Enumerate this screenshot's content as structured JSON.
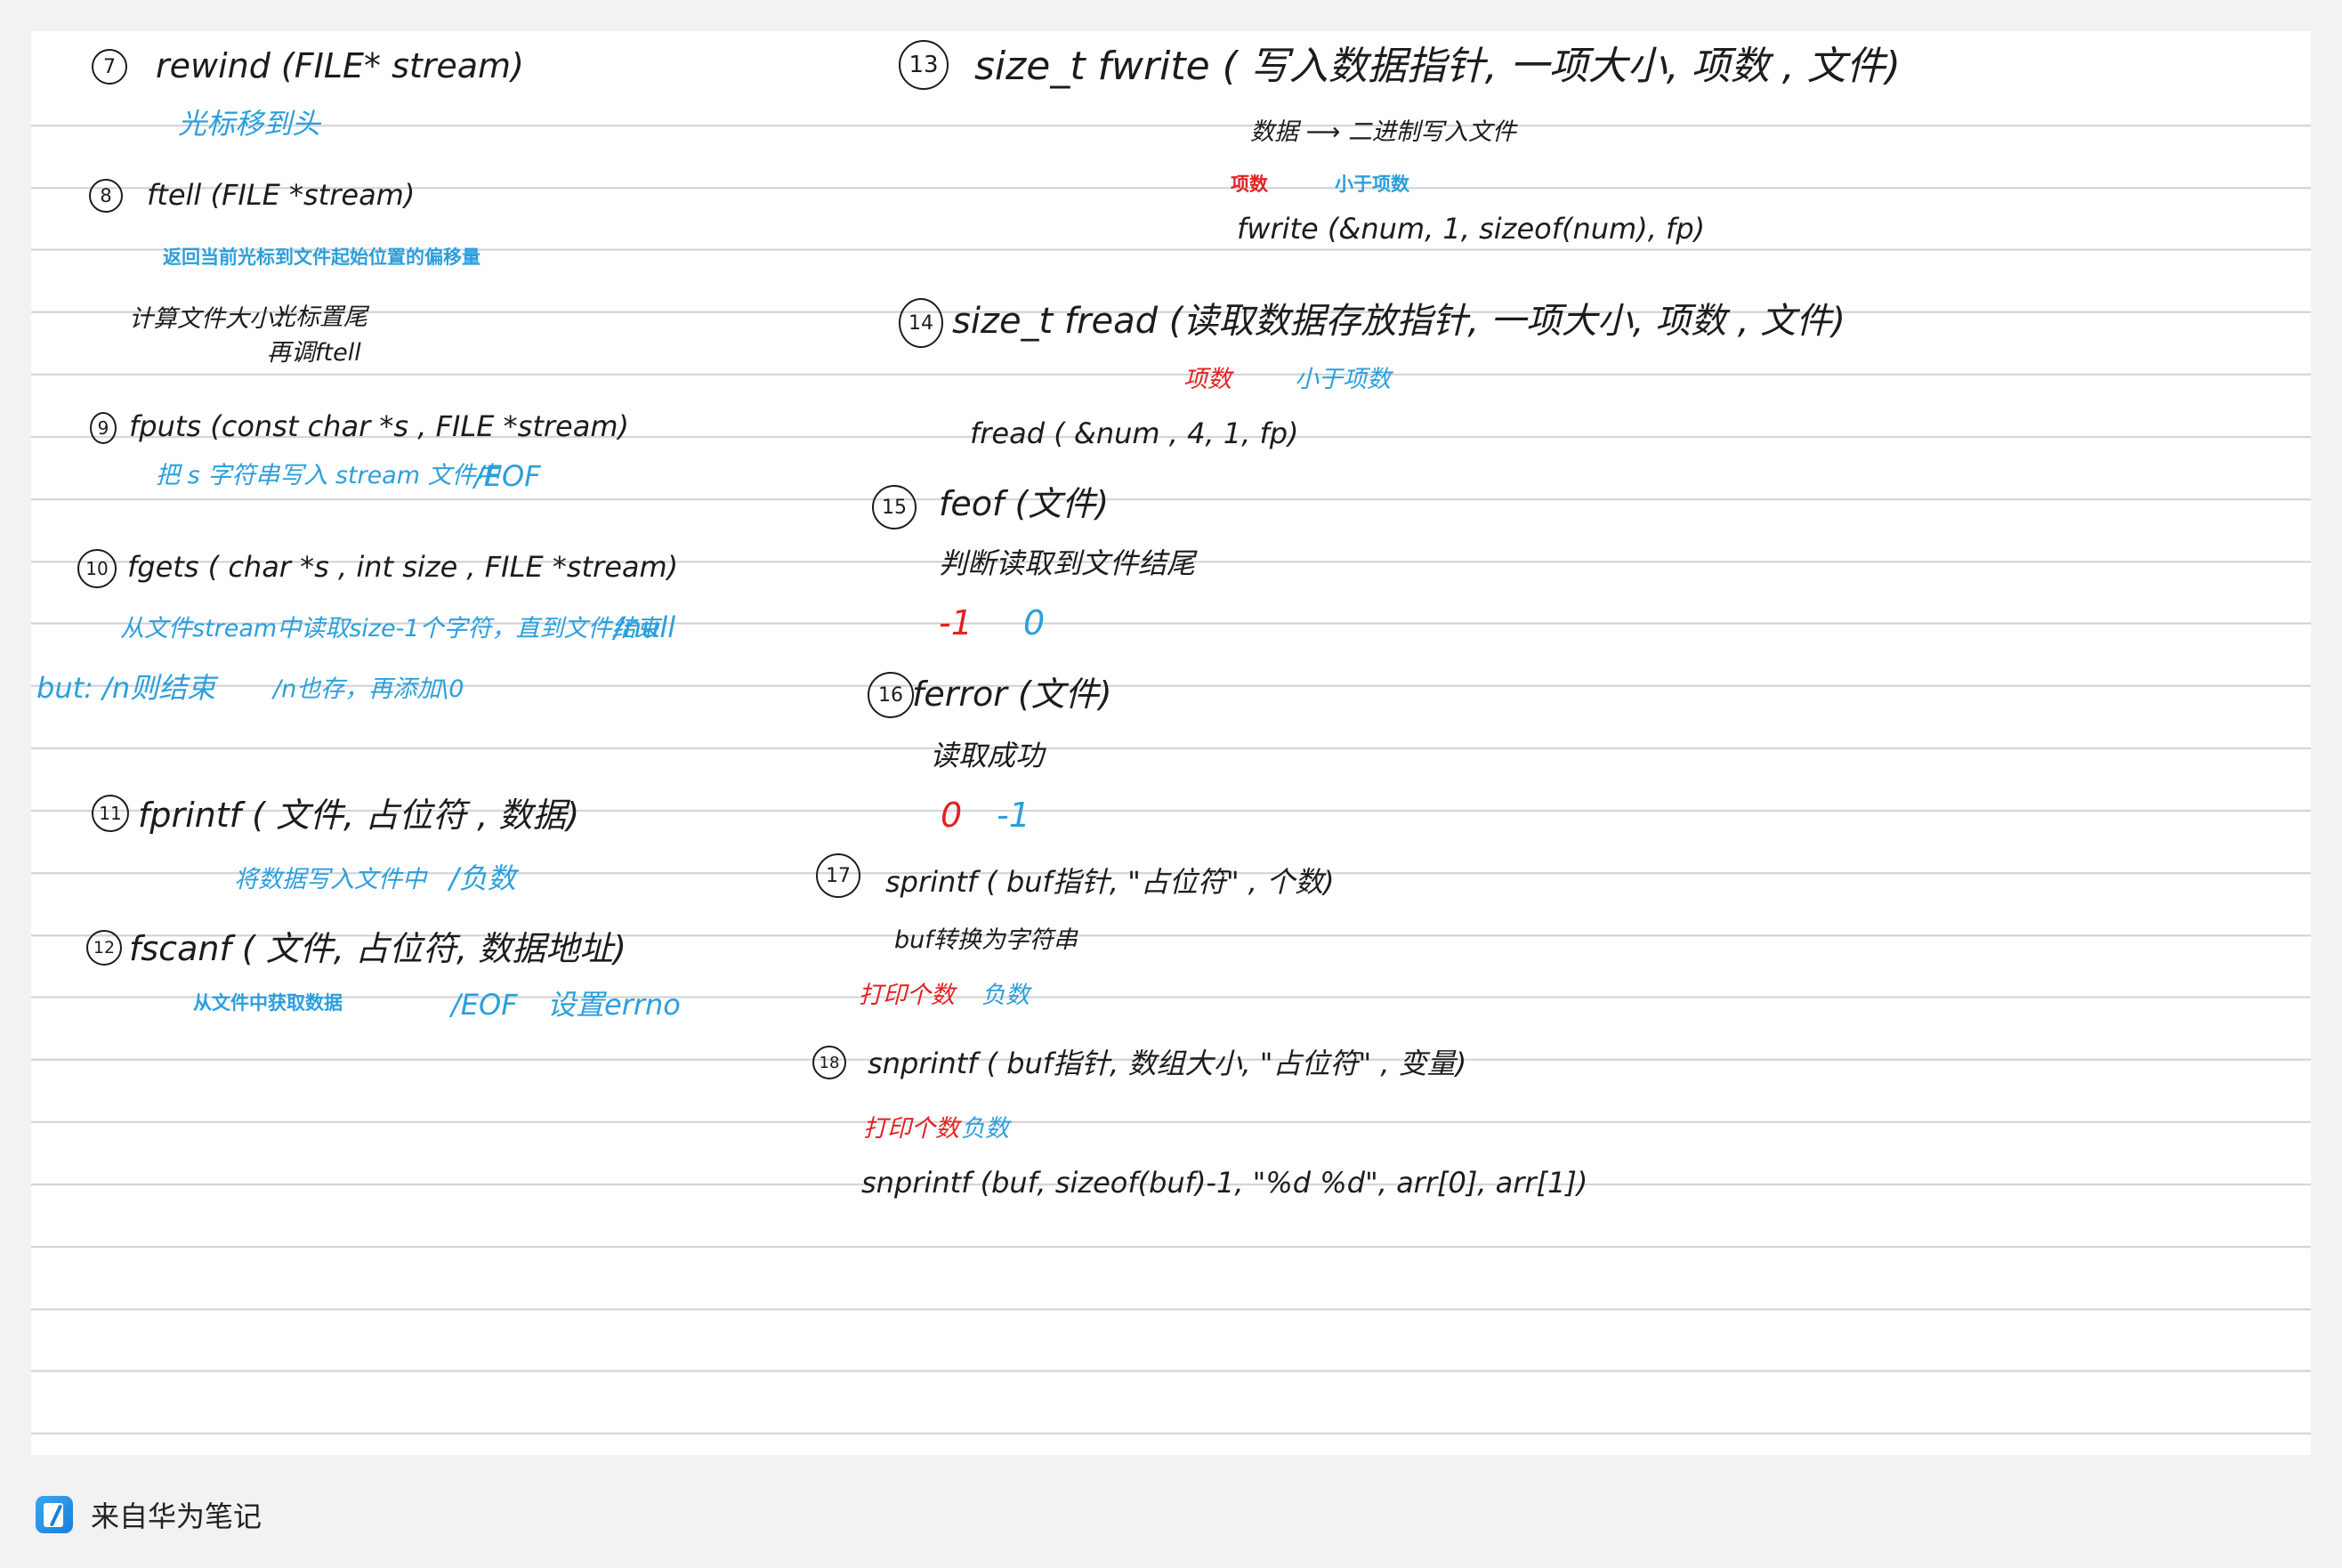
{
  "notes": {
    "n7": {
      "num": "7",
      "sig": "rewind (FILE* stream)",
      "desc": "光标移到头"
    },
    "n8": {
      "num": "8",
      "sig": "ftell (FILE *stream)",
      "desc": "返回当前光标到文件起始位置的偏移量",
      "calc_label": "计算文件大小：",
      "calc_1": "光标置尾",
      "calc_2": "再调ftell"
    },
    "n9": {
      "num": "9",
      "sig": "fputs (const char *s , FILE *stream)",
      "desc": "把 s 字符串写入 stream 文件中",
      "ret": "/EOF"
    },
    "n10": {
      "num": "10",
      "sig": "fgets ( char *s , int size , FILE *stream)",
      "desc": "从文件stream中读取size-1个字符，直到文件结束",
      "ret": "/null",
      "but": "but: /n则结束",
      "note": "/n也存，再添加\\0"
    },
    "n11": {
      "num": "11",
      "sig": "fprintf ( 文件, 占位符 , 数据)",
      "desc": "将数据写入文件中",
      "ret": "/负数"
    },
    "n12": {
      "num": "12",
      "sig": "fscanf ( 文件, 占位符, 数据地址)",
      "desc": "从文件中获取数据",
      "ret": "/EOF",
      "errno": "设置errno"
    },
    "n13": {
      "num": "13",
      "sig": "size_t fwrite ( 写入数据指针, 一项大小, 项数 , 文件)",
      "desc": "数据 ⟶ 二进制写入文件",
      "ret_red": "项数",
      "ret_blue": "小于项数",
      "example": "fwrite (&num, 1, sizeof(num), fp)"
    },
    "n14": {
      "num": "14",
      "sig": "size_t fread (读取数据存放指针, 一项大小, 项数 , 文件)",
      "ret_red": "项数",
      "ret_blue": "小于项数",
      "example": "fread ( &num , 4, 1, fp)"
    },
    "n15": {
      "num": "15",
      "sig": "feof (文件)",
      "desc": "判断读取到文件结尾",
      "ret_red": "-1",
      "ret_blue": "0"
    },
    "n16": {
      "num": "16",
      "sig": "ferror (文件)",
      "desc": "读取成功",
      "ret_red": "0",
      "ret_blue": "-1"
    },
    "n17": {
      "num": "17",
      "sig": "sprintf ( buf指针, \"占位符\" , 个数)",
      "desc": "buf转换为字符串",
      "ret_red": "打印个数",
      "ret_blue": "负数"
    },
    "n18": {
      "num": "18",
      "sig": "snprintf ( buf指针, 数组大小, \"占位符\" , 变量)",
      "ret_red": "打印个数",
      "ret_blue": "负数",
      "example": "snprintf (buf, sizeof(buf)-1, \"%d %d\", arr[0], arr[1])"
    }
  },
  "footer": {
    "label": "来自华为笔记",
    "icon": "notes-app-icon"
  },
  "colors": {
    "ink": "#1c1c1c",
    "blue": "#2b9fdc",
    "red": "#e32121",
    "rule": "#d0d0d4",
    "paper": "#ffffff",
    "background": "#f2f2f4"
  }
}
